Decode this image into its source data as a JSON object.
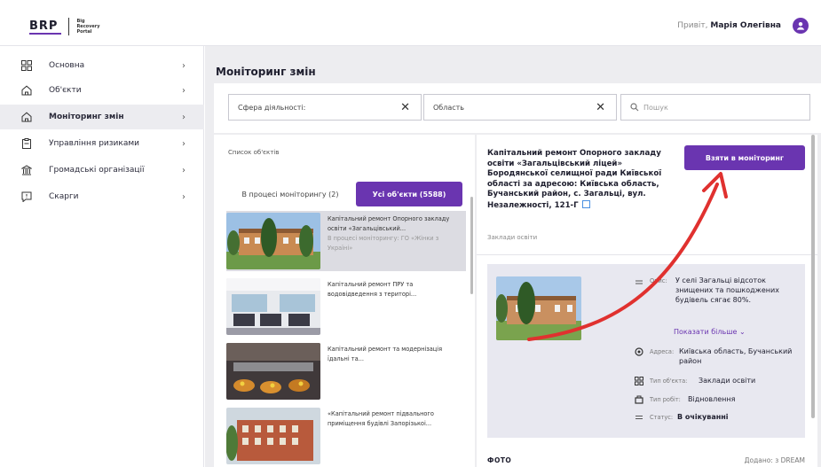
{
  "header": {
    "logo_abbr": "BRP",
    "logo_name_line1": "Big",
    "logo_name_line2": "Recovery",
    "logo_name_line3": "Portal",
    "greeting_prefix": "Привіт,",
    "user_name": "Марія Олегівна",
    "user_icon": "user-circle-icon"
  },
  "sidebar": {
    "items": [
      {
        "label": "Основна",
        "icon": "grid-icon"
      },
      {
        "label": "Об'єкти",
        "icon": "home-icon"
      },
      {
        "label": "Моніторинг змін",
        "icon": "home-icon",
        "active": true
      },
      {
        "label": "Управління ризиками",
        "icon": "clipboard-icon"
      },
      {
        "label": "Громадські організації",
        "icon": "building-icon"
      },
      {
        "label": "Скарги",
        "icon": "message-icon"
      }
    ]
  },
  "main": {
    "title": "Моніторинг змін",
    "filters": {
      "sphere_placeholder": "Сфера діяльності:",
      "region_placeholder": "Область",
      "search_placeholder": "Пошук"
    },
    "list": {
      "title": "Список об'єктів",
      "tab_in_progress": "В процесі моніторингу (2)",
      "tab_all": "Усі об'єкти (5588)",
      "items": [
        {
          "title": "Капітальний ремонт Опорного закладу освіти «Загальцівський...",
          "subtitle": "В процесі моніторингу: ГО «Жінки з Україні»"
        },
        {
          "title": "Капітальний ремонт ПРУ та водовідведення з територі...",
          "subtitle": ""
        },
        {
          "title": "Капітальний ремонт та модернізація їдальні та...",
          "subtitle": ""
        },
        {
          "title": "«Капітальний ремонт підвального приміщення будівлі Запорізькоі...",
          "subtitle": ""
        }
      ]
    },
    "detail": {
      "title": "Капітальний ремонт Опорного закладу освіти «Загальцівський ліцей» Бородянської селищної ради Київської області за адресою: Київська область, Бучанський район, с. Загальці, вул. Незалежності, 121-Г",
      "category": "Заклади освіти",
      "monitor_button": "Взяти в моніторинг",
      "description_key": "Опис:",
      "description_val": "У селі Загальці відсоток знищених та пошкоджених будівель сягає 80%.",
      "show_more": "Показати більше",
      "address_key": "Адреса:",
      "address_val": "Київська область, Бучанський район",
      "type_key": "Тип об'єкта:",
      "type_val": "Заклади освіти",
      "work_key": "Тип робіт:",
      "work_val": "Відновлення",
      "status_key": "Статус:",
      "status_val": "В очікуванні",
      "photos_label": "ФОТО",
      "added_label": "Додано: з DREAM"
    }
  },
  "colors": {
    "accent": "#6a35b0",
    "arrow": "#e0312f",
    "link": "#4a90e2"
  }
}
